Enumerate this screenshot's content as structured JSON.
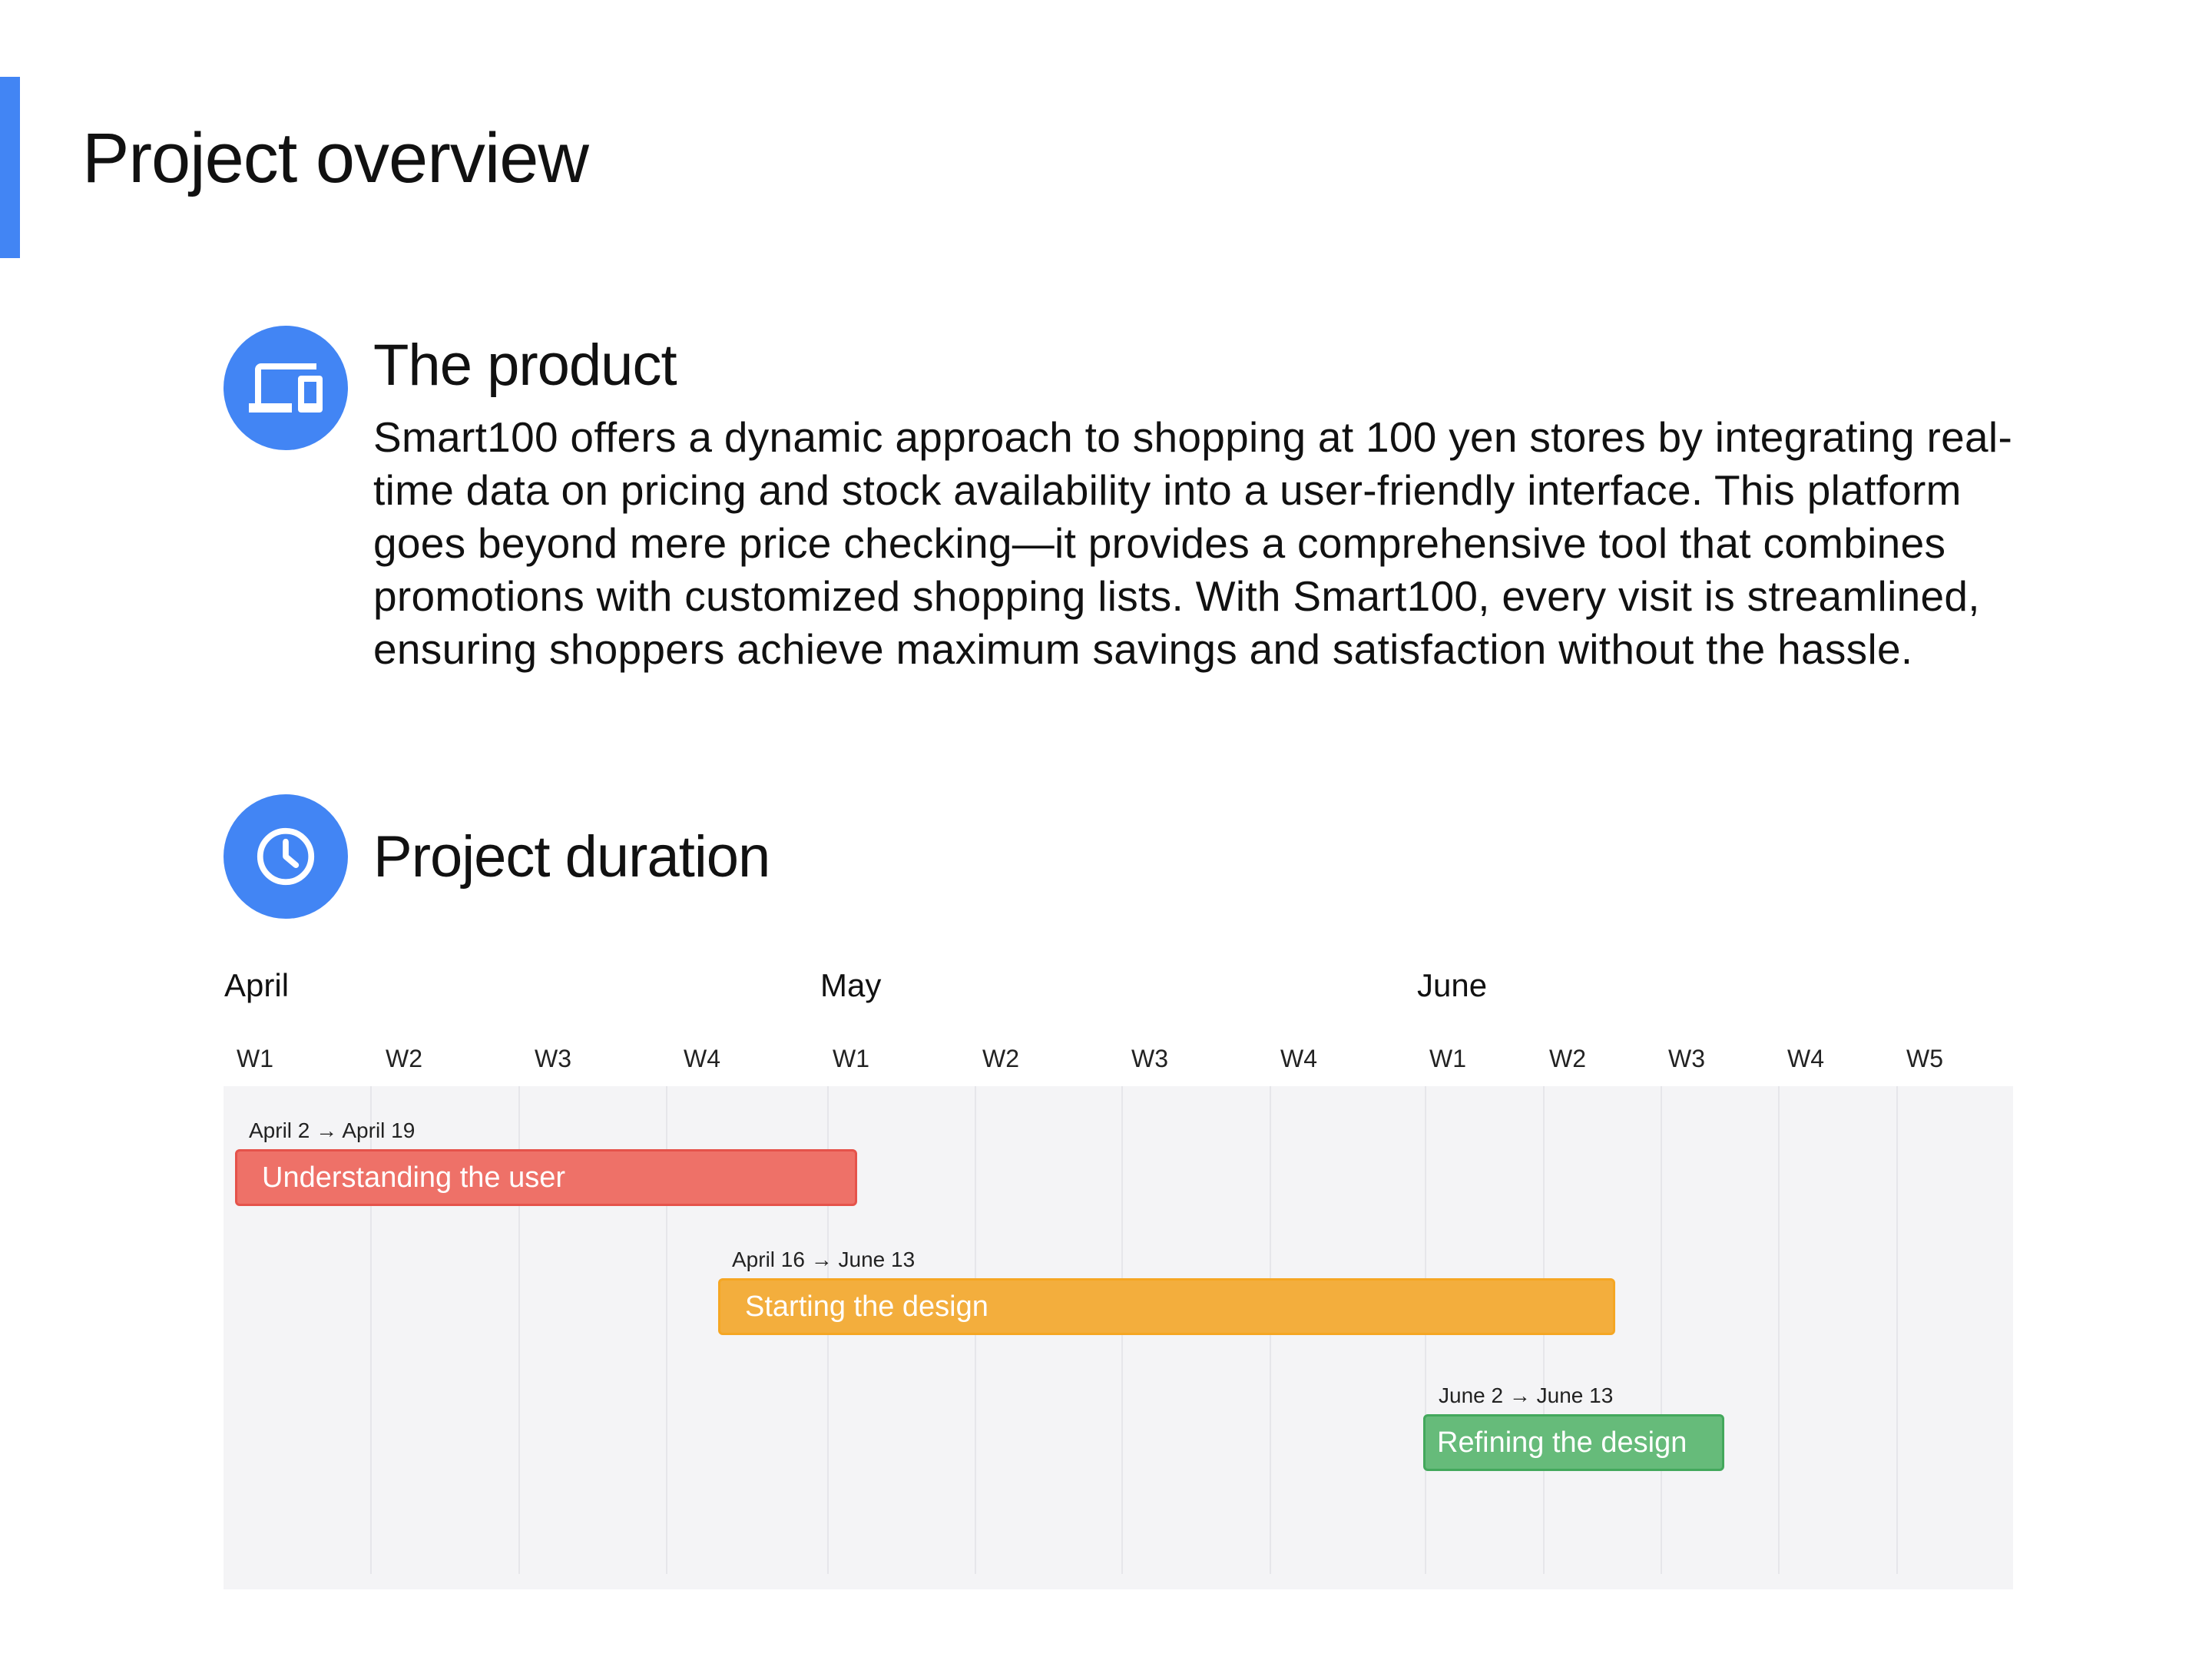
{
  "page": {
    "title": "Project overview",
    "accent_color": "#4285f4"
  },
  "product": {
    "icon": "devices-icon",
    "heading": "The product",
    "text": "Smart100 offers a dynamic approach to shopping at 100 yen stores by integrating real-time data on pricing and stock availability into a user-friendly interface. This platform goes beyond mere price checking—it provides a comprehensive tool that combines promotions with customized shopping lists. With Smart100, every visit is streamlined, ensuring shoppers achieve maximum savings and satisfaction without the hassle."
  },
  "duration": {
    "icon": "clock-icon",
    "heading": "Project duration"
  },
  "timeline": {
    "months": [
      "April",
      "May",
      "June"
    ],
    "weeks": [
      "W1",
      "W2",
      "W3",
      "W4",
      "W1",
      "W2",
      "W3",
      "W4",
      "W1",
      "W2",
      "W3",
      "W4",
      "W5"
    ],
    "tasks": [
      {
        "name": "Understanding the user",
        "range": "April 2 → April 19",
        "color": "#ee7168"
      },
      {
        "name": "Starting the design",
        "range": "April 16 → June 13",
        "color": "#f3ae3d"
      },
      {
        "name": "Refining the design",
        "range": "June 2 → June 13",
        "color": "#66bb7a"
      }
    ]
  }
}
